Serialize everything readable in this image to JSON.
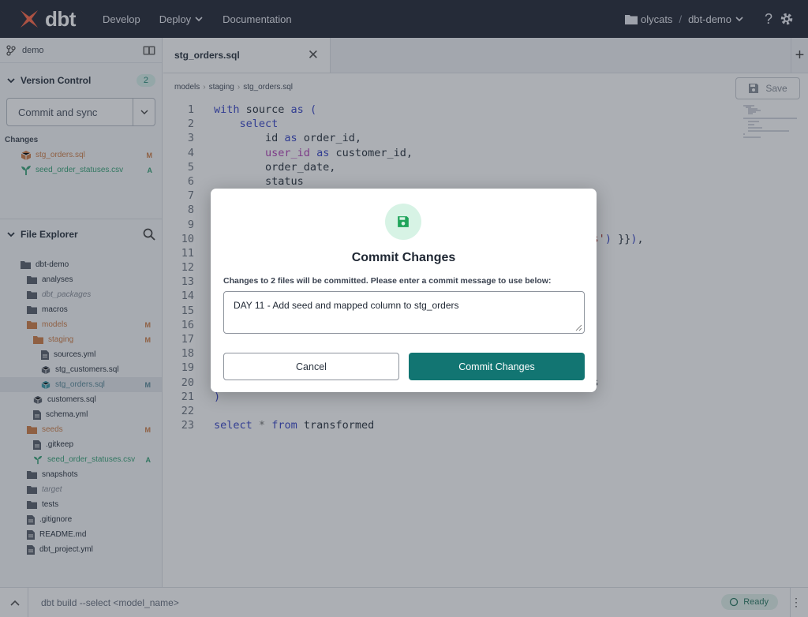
{
  "topbar": {
    "logo_text": "dbt",
    "nav": [
      "Develop",
      "Deploy",
      "Documentation"
    ],
    "account": "olycats",
    "separator": "/",
    "project": "dbt-demo",
    "help_icon": "?"
  },
  "sidebar": {
    "branch": "demo",
    "version_control": {
      "title": "Version Control",
      "count": "2"
    },
    "commit_sync_label": "Commit and sync",
    "changes_label": "Changes",
    "changes": [
      {
        "name": "stg_orders.sql",
        "status": "M",
        "color": "#d0804a"
      },
      {
        "name": "seed_order_statuses.csv",
        "status": "A",
        "color": "#3aa57a"
      }
    ],
    "file_explorer": {
      "title": "File Explorer"
    },
    "tree": [
      {
        "name": "dbt-demo",
        "type": "folder",
        "status": ""
      },
      {
        "name": "analyses",
        "type": "folder",
        "status": ""
      },
      {
        "name": "dbt_packages",
        "type": "folder",
        "status": ""
      },
      {
        "name": "macros",
        "type": "folder",
        "status": ""
      },
      {
        "name": "models",
        "type": "folder",
        "status": "M"
      },
      {
        "name": "staging",
        "type": "folder",
        "status": "M"
      },
      {
        "name": "sources.yml",
        "type": "file",
        "status": ""
      },
      {
        "name": "stg_customers.sql",
        "type": "model",
        "status": ""
      },
      {
        "name": "stg_orders.sql",
        "type": "model",
        "status": "M"
      },
      {
        "name": "customers.sql",
        "type": "model",
        "status": ""
      },
      {
        "name": "schema.yml",
        "type": "file",
        "status": ""
      },
      {
        "name": "seeds",
        "type": "folder",
        "status": "M"
      },
      {
        "name": ".gitkeep",
        "type": "file",
        "status": ""
      },
      {
        "name": "seed_order_statuses.csv",
        "type": "seed",
        "status": "A"
      },
      {
        "name": "snapshots",
        "type": "folder",
        "status": ""
      },
      {
        "name": "target",
        "type": "folder",
        "status": ""
      },
      {
        "name": "tests",
        "type": "folder",
        "status": ""
      },
      {
        "name": ".gitignore",
        "type": "file",
        "status": ""
      },
      {
        "name": "README.md",
        "type": "file",
        "status": ""
      },
      {
        "name": "dbt_project.yml",
        "type": "file",
        "status": ""
      }
    ]
  },
  "editor": {
    "tab": "stg_orders.sql",
    "tab_close": "✕",
    "add_tab": "+",
    "breadcrumb": [
      "models",
      "staging",
      "stg_orders.sql"
    ],
    "save_label": "Save",
    "code_lines": [
      "with source as (",
      "    select",
      "        id as order_id,",
      "        user_id as customer_id,",
      "        order_date,",
      "        status",
      "",
      "",
      "",
      "                                                      atuses') }}),",
      "",
      "",
      "",
      "",
      "",
      "",
      "",
      "",
      "",
      "                                                      status",
      ")",
      "",
      "select * from transformed"
    ]
  },
  "bottombar": {
    "command_placeholder": "dbt build --select <model_name>",
    "status": "Ready"
  },
  "modal": {
    "title": "Commit Changes",
    "description": "Changes to 2 files will be committed. Please enter a commit message to use below:",
    "message": "DAY 11 - Add seed and mapped column to stg_orders",
    "cancel_label": "Cancel",
    "commit_label": "Commit Changes"
  }
}
